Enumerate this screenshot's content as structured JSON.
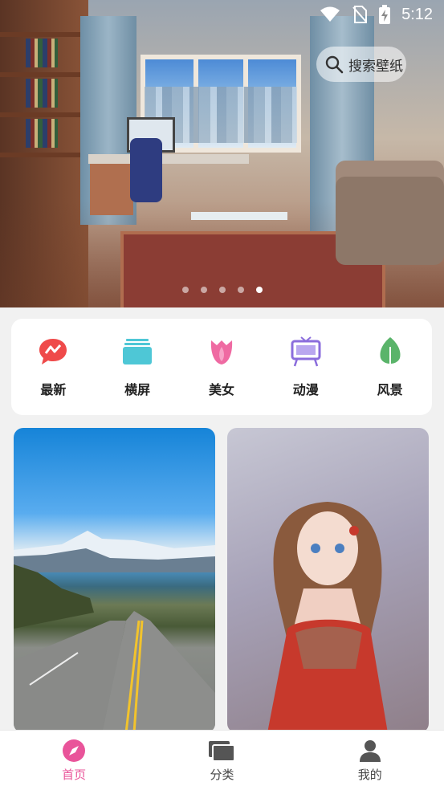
{
  "status_bar": {
    "time": "5:12"
  },
  "banner": {
    "search_placeholder": "搜索壁纸",
    "pager": {
      "count": 5,
      "active_index": 4
    }
  },
  "categories": [
    {
      "label": "最新",
      "icon": "chat-bubble-icon",
      "color": "#ef4a4a"
    },
    {
      "label": "横屏",
      "icon": "stacked-layers-icon",
      "color": "#4ec7d6"
    },
    {
      "label": "美女",
      "icon": "tulip-icon",
      "color": "#ef6aa2"
    },
    {
      "label": "动漫",
      "icon": "easel-tv-icon",
      "color": "#8b6ddc"
    },
    {
      "label": "风景",
      "icon": "leaf-icon",
      "color": "#5ab46a"
    }
  ],
  "wallpapers": [
    {
      "name": "mountain-road-landscape"
    },
    {
      "name": "anime-girl-red-dress"
    }
  ],
  "bottom_nav": [
    {
      "label": "首页",
      "icon": "compass-icon",
      "active": true
    },
    {
      "label": "分类",
      "icon": "folders-icon",
      "active": false
    },
    {
      "label": "我的",
      "icon": "person-icon",
      "active": false
    }
  ],
  "colors": {
    "accent": "#e9549a",
    "background": "#f1f1f1"
  }
}
